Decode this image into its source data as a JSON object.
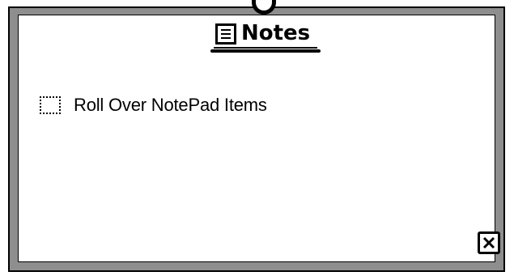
{
  "window": {
    "title": "Notes",
    "title_icon": "notes-icon",
    "close_icon": "close-icon"
  },
  "items": [
    {
      "label": "Roll Over NotePad Items",
      "checked": false
    }
  ],
  "colors": {
    "frame_border": "#000000",
    "frame_fill": "#8e8e8e",
    "background": "#ffffff",
    "text": "#000000"
  }
}
